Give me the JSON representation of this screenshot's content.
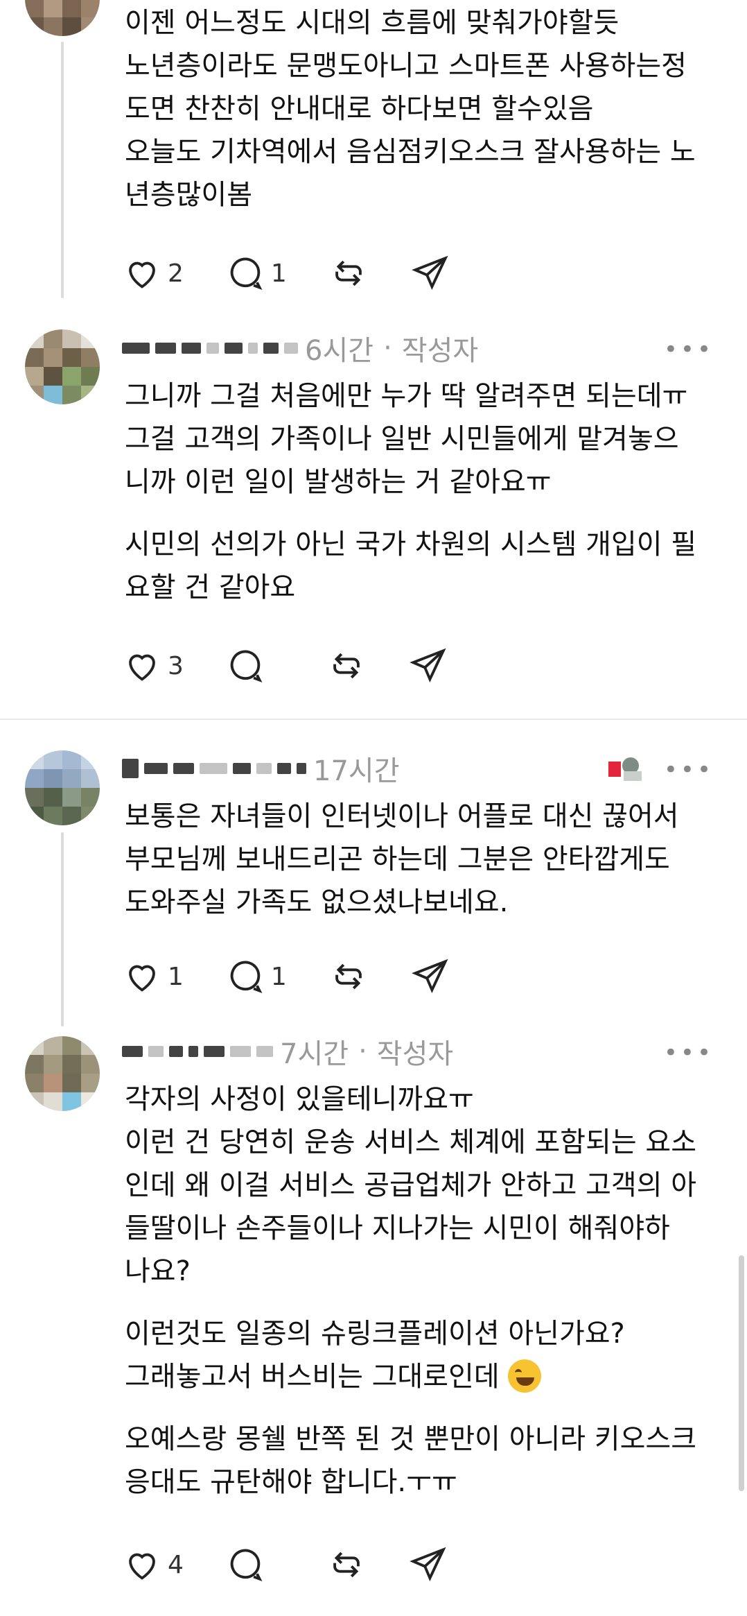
{
  "comments": [
    {
      "lines": [
        [
          "이젠 어느정도 시대의 흐름에 맞춰가야할듯",
          "노년층이라도 문맹도아니고 스마트폰 사용하는정",
          "도면 찬찬히 안내대로 하다보면 할수있음",
          "오늘도 기차역에서 음심점키오스크 잘사용하는 노",
          "년층많이봄"
        ]
      ],
      "likes": "2",
      "replies": "1"
    },
    {
      "time": "6시간",
      "separator": "·",
      "author_label": "작성자",
      "lines": [
        [
          "그니까 그걸 처음에만 누가 딱 알려주면 되는데ㅠ",
          "그걸 고객의 가족이나 일반 시민들에게 맡겨놓으",
          "니까 이런 일이 발생하는 거 같아요ㅠ"
        ],
        [
          "시민의 선의가 아닌 국가 차원의 시스템 개입이 필",
          "요할 건 같아요"
        ]
      ],
      "likes": "3",
      "replies": ""
    },
    {
      "time": "17시간",
      "lines": [
        [
          "보통은 자녀들이 인터넷이나 어플로 대신 끊어서",
          "부모님께 보내드리곤 하는데 그분은 안타깝게도",
          "도와주실 가족도 없으셨나보네요."
        ]
      ],
      "likes": "1",
      "replies": "1"
    },
    {
      "time": "7시간",
      "separator": "·",
      "author_label": "작성자",
      "lines": [
        [
          "각자의 사정이 있을테니까요ㅠ",
          "이런 건 당연히 운송 서비스 체계에 포함되는 요소",
          "인데 왜 이걸 서비스 공급업체가 안하고 고객의 아",
          "들딸이나 손주들이나 지나가는 시민이 해줘야하",
          "나요?"
        ],
        [
          "이런것도 일종의 슈링크플레이션 아닌가요?",
          "그래놓고서 버스비는 그대로인데"
        ],
        [
          "오예스랑 몽쉘 반쪽 된 것 뿐만이 아니라 키오스크",
          "응대도 규탄해야 합니다.ㅜㅠ"
        ]
      ],
      "likes": "4",
      "replies": ""
    }
  ],
  "more_label": "•••",
  "icons": [
    "heart-icon",
    "comment-icon",
    "repost-icon",
    "send-icon",
    "more-icon",
    "laughing-emoji-icon"
  ]
}
